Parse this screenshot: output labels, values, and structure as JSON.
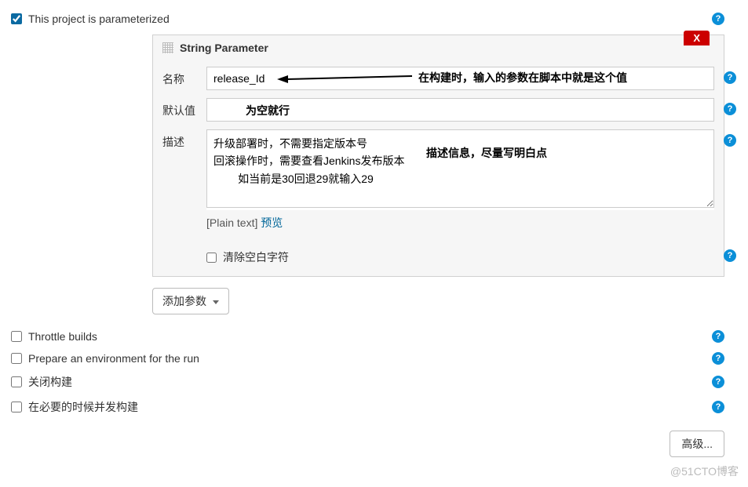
{
  "options": {
    "parametrized": {
      "label": "This project is parameterized",
      "checked": true
    },
    "throttle": {
      "label": "Throttle builds",
      "checked": false
    },
    "prepare_env": {
      "label": "Prepare an environment for the run",
      "checked": false
    },
    "close_build": {
      "label": "关闭构建",
      "checked": false
    },
    "concurrent": {
      "label": "在必要的时候并发构建",
      "checked": false
    }
  },
  "string_param": {
    "title": "String Parameter",
    "close_label": "X",
    "name_label": "名称",
    "name_value": "release_Id",
    "default_label": "默认值",
    "default_value": "",
    "desc_label": "描述",
    "desc_value": "升级部署时，不需要指定版本号\n回滚操作时，需要查看Jenkins发布版本\n        如当前是30回退29就输入29",
    "plain_text_label": "[Plain text]",
    "preview_label": "预览",
    "strip_ws_label": "清除空白字符",
    "strip_ws_checked": false
  },
  "annotations": {
    "name_note": "在构建时，输入的参数在脚本中就是这个值",
    "default_note": "为空就行",
    "desc_note": "描述信息，尽量写明白点"
  },
  "buttons": {
    "add_param": "添加参数",
    "advanced": "高级..."
  },
  "watermark": "@51CTO博客"
}
